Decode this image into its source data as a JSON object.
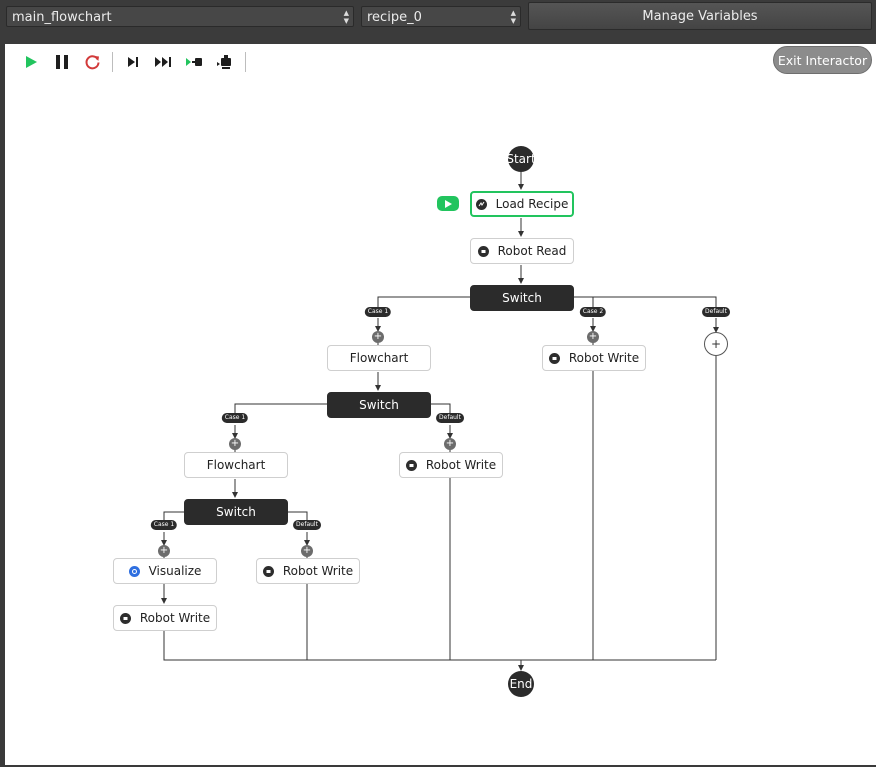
{
  "header": {
    "flowchart_select": "main_flowchart",
    "recipe_select": "recipe_0",
    "manage_variables_label": "Manage Variables"
  },
  "canvas": {
    "exit_label": "Exit Interactor",
    "toolbar": {
      "play": "play-icon",
      "pause": "pause-icon",
      "restart": "restart-icon",
      "step": "step-icon",
      "skip": "skip-forward-icon",
      "step_into": "step-into-icon",
      "step_robot": "robot-step-icon"
    },
    "colors": {
      "run_green": "#22c45e",
      "node_dark": "#2b2b2b",
      "visualize_blue": "#2f6fe0"
    }
  },
  "flow": {
    "start": "Start",
    "end": "End",
    "load_recipe": "Load Recipe",
    "robot_read": "Robot Read",
    "switch_1": "Switch",
    "case1_a": "Case 1",
    "case2_a": "Case 2",
    "default_a": "Default",
    "flowchart_1": "Flowchart",
    "robot_write_1": "Robot Write",
    "switch_2": "Switch",
    "case1_b": "Case 1",
    "default_b": "Default",
    "flowchart_2": "Flowchart",
    "robot_write_2": "Robot Write",
    "switch_3": "Switch",
    "case1_c": "Case 1",
    "default_c": "Default",
    "visualize": "Visualize",
    "robot_write_3": "Robot Write",
    "robot_write_4": "Robot Write",
    "plus": "+"
  }
}
